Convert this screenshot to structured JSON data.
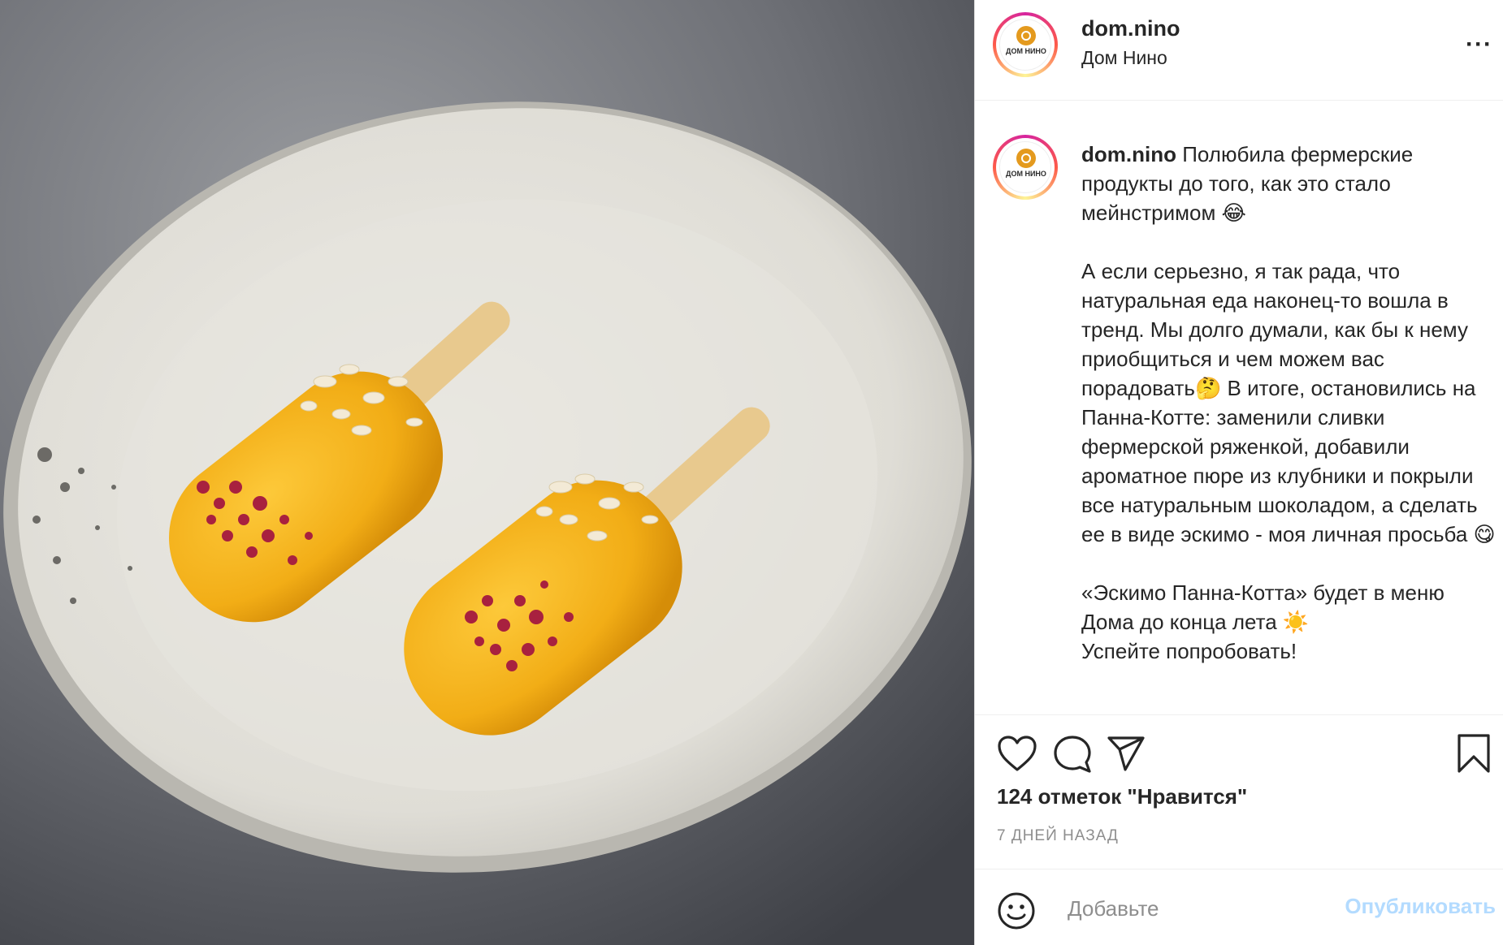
{
  "header": {
    "username": "dom.nino",
    "location": "Дом Нино",
    "more_icon": "more-horizontal-icon",
    "more_label": "···"
  },
  "avatar": {
    "logo_text": "ДОМ НИНО"
  },
  "caption": {
    "username": "dom.nino",
    "p1": " Полюбила фермерские продукты до того, как это стало мейнстримом 😂",
    "p2": "А если серьезно, я так рада, что натуральная еда наконец-то вошла в тренд. Мы долго думали, как бы к нему приобщиться и чем можем вас порадовать🤔 В итоге, остановились на Панна-Котте: заменили сливки фермерской ряженкой, добавили ароматное пюре из клубники и покрыли все натуральным шоколадом, а сделать ее в виде эскимо - моя личная просьба 😋",
    "p3_line1": "«Эскимо Панна-Котта» будет в меню Дома до конца лета ☀️",
    "p3_line2": "Успейте попробовать!"
  },
  "actions": {
    "like_icon": "heart-icon",
    "comment_icon": "comment-bubble-icon",
    "share_icon": "paper-plane-icon",
    "save_icon": "bookmark-icon"
  },
  "likes": "124 отметок \"Нравится\"",
  "date": "7 ДНЕЙ НАЗАД",
  "comment_box": {
    "emoji_icon": "smiley-icon",
    "placeholder": "Добавьте",
    "publish_label": "Опубликовать"
  },
  "colors": {
    "text": "#262626",
    "muted": "#8e8e8e",
    "publish_disabled": "#b3dbff",
    "popsicle": "#f4b31b"
  }
}
